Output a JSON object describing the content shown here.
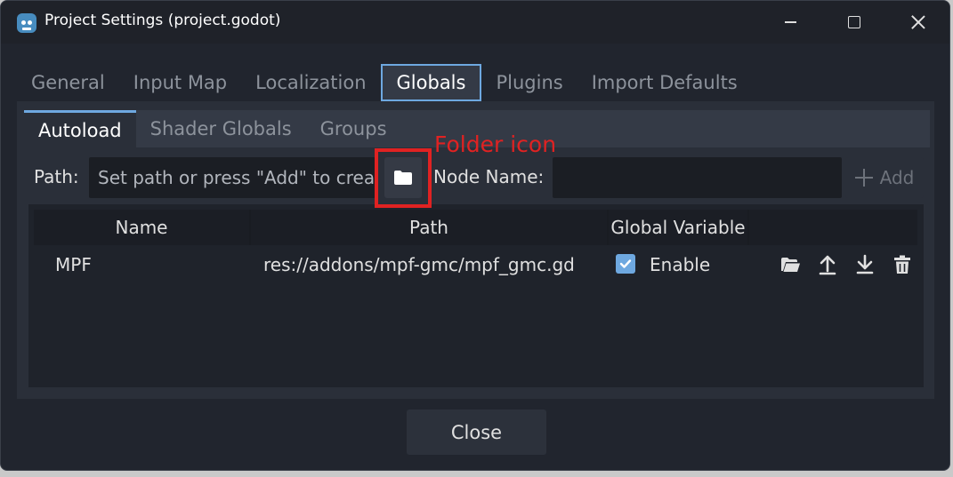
{
  "window": {
    "title": "Project Settings (project.godot)",
    "app_icon": "godot-icon",
    "minimize_icon": "minimize-icon",
    "maximize_icon": "maximize-icon",
    "close_icon": "close-icon"
  },
  "tabs": [
    {
      "label": "General",
      "active": false
    },
    {
      "label": "Input Map",
      "active": false
    },
    {
      "label": "Localization",
      "active": false
    },
    {
      "label": "Globals",
      "active": true
    },
    {
      "label": "Plugins",
      "active": false
    },
    {
      "label": "Import Defaults",
      "active": false
    }
  ],
  "subtabs": [
    {
      "label": "Autoload",
      "active": true
    },
    {
      "label": "Shader Globals",
      "active": false
    },
    {
      "label": "Groups",
      "active": false
    }
  ],
  "autoload": {
    "path_label": "Path:",
    "path_placeholder": "Set path or press \"Add\" to crea",
    "browse_icon": "folder-icon",
    "node_name_label": "Node Name:",
    "node_name_value": "",
    "add_label": "Add",
    "add_icon": "plus-icon"
  },
  "table": {
    "columns": [
      "Name",
      "Path",
      "Global Variable"
    ],
    "rows": [
      {
        "name": "MPF",
        "path": "res://addons/mpf-gmc/mpf_gmc.gd",
        "enable_label": "Enable",
        "enabled": true,
        "actions": [
          "open-folder-icon",
          "move-up-icon",
          "move-down-icon",
          "trash-icon"
        ]
      }
    ]
  },
  "annotation": {
    "label": "Folder icon",
    "color": "#e02222"
  },
  "footer": {
    "close_label": "Close"
  },
  "colors": {
    "accent": "#6ea8e0",
    "window_bg": "#21252e",
    "panel_bg": "#2a2f39"
  }
}
